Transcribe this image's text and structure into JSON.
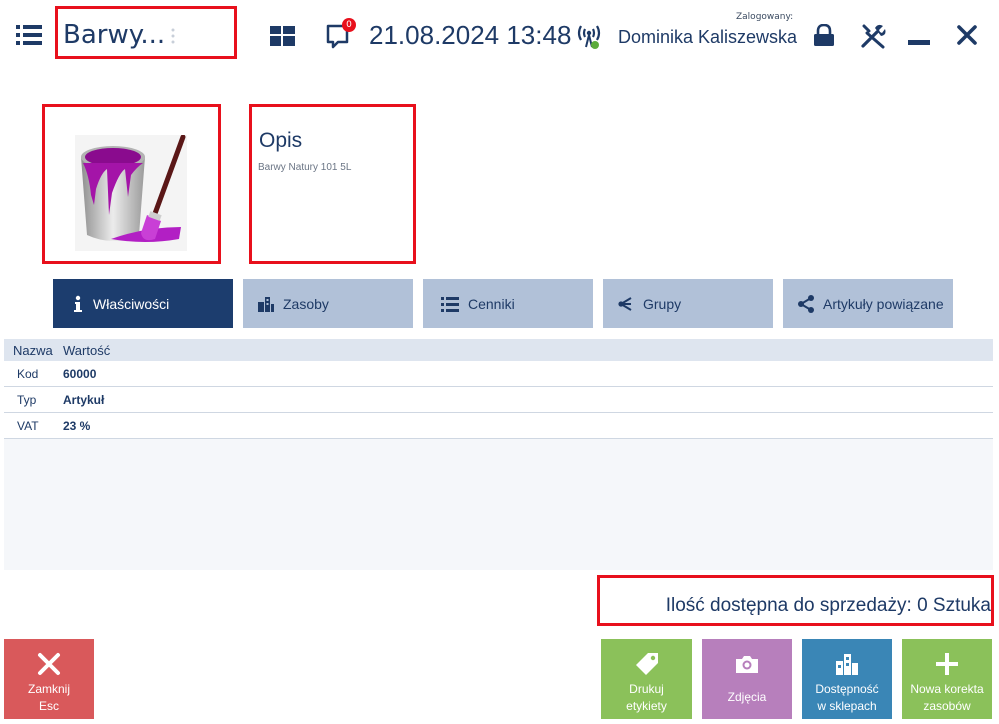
{
  "header": {
    "title": "Barwy...",
    "notification_count": "0",
    "datetime": "21.08.2024 13:48",
    "logged_label": "Zalogowany:",
    "user_name": "Dominika Kaliszewska"
  },
  "product": {
    "description_title": "Opis",
    "description": "Barwy Natury 101 5L"
  },
  "tabs": [
    {
      "label": "Właściwości",
      "icon": "info-icon",
      "active": true
    },
    {
      "label": "Zasoby",
      "icon": "buildings-icon",
      "active": false
    },
    {
      "label": "Cenniki",
      "icon": "list-icon",
      "active": false
    },
    {
      "label": "Grupy",
      "icon": "group-icon",
      "active": false
    },
    {
      "label": "Artykuły powiązane",
      "icon": "share-icon",
      "active": false
    }
  ],
  "table": {
    "columns": [
      "Nazwa",
      "Wartość"
    ],
    "rows": [
      {
        "name": "Kod",
        "value": "60000"
      },
      {
        "name": "Typ",
        "value": "Artykuł"
      },
      {
        "name": "VAT",
        "value": "23 %"
      }
    ]
  },
  "availability": {
    "label": "Ilość dostępna do sprzedaży:",
    "value": "0 Sztuka"
  },
  "buttons": {
    "close": {
      "line1": "Zamknij",
      "line2": "Esc"
    },
    "print": {
      "line1": "Drukuj",
      "line2": "etykiety"
    },
    "photos": {
      "line1": "Zdjęcia"
    },
    "availability": {
      "line1": "Dostępność",
      "line2": "w sklepach"
    },
    "correction": {
      "line1": "Nowa korekta",
      "line2": "zasobów"
    }
  },
  "colors": {
    "accent_dark": "#1c3d6e",
    "tab_inactive": "#b1c1d8",
    "highlight_red": "#e8101c",
    "close_button": "#d9595b",
    "green_button": "#8bc15a",
    "purple_button": "#b77fbc",
    "blue_button": "#3a86b6"
  }
}
